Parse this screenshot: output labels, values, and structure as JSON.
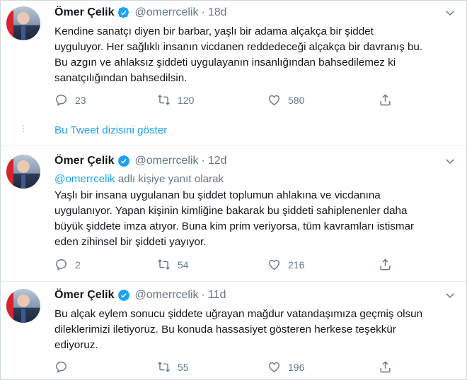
{
  "tweets": [
    {
      "name": "Ömer Çelik",
      "handle": "@omerrcelik",
      "time": "18d",
      "reply_prefix": "",
      "reply_mention": "",
      "reply_suffix": "",
      "lines": [
        "Kendine sanatçı diyen bir barbar, yaşlı bir adama alçakça bir şiddet",
        "uyguluyor. Her sağlıklı insanın vicdanen reddedeceği alçakça bir davranış bu.",
        "Bu azgın ve ahlaksız şiddeti uygulayanın insanlığından bahsedilemez ki",
        "sanatçılığından bahsedilsin."
      ],
      "replies": "23",
      "retweets": "120",
      "likes": "580"
    },
    {
      "name": "Ömer Çelik",
      "handle": "@omerrcelik",
      "time": "12d",
      "reply_mention": "@omerrcelik",
      "reply_suffix": "adlı kişiye yanıt olarak",
      "lines": [
        "Yaşlı bir insana uygulanan bu şiddet toplumun ahlakına ve vicdanına",
        "uygulanıyor. Yapan kişinin kimliğine bakarak bu şiddeti sahiplenenler daha",
        "büyük şiddete imza atıyor. Buna kim prim veriyorsa, tüm kavramları istismar",
        "eden zihinsel bir şiddeti yayıyor."
      ],
      "replies": "2",
      "retweets": "54",
      "likes": "216"
    },
    {
      "name": "Ömer Çelik",
      "handle": "@omerrcelik",
      "time": "11d",
      "lines": [
        "Bu alçak eylem sonucu şiddete uğrayan mağdur vatandaşımıza geçmiş olsun",
        "dileklerimizi iletiyoruz. Bu konuda hassasiyet gösteren herkese teşekkür",
        "ediyoruz."
      ],
      "replies": "",
      "retweets": "55",
      "likes": "196"
    }
  ],
  "show_thread_label": "Bu Tweet dizisini göster",
  "dot_separator": "·",
  "colors": {
    "link": "#1da1f2",
    "muted": "#657786",
    "text": "#14171a",
    "verified": "#1da1f2"
  }
}
